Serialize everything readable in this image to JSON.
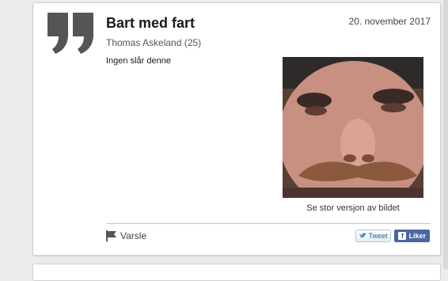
{
  "post": {
    "title": "Bart med fart",
    "date": "20. november 2017",
    "author": "Thomas Askeland (25)",
    "text": "Ingen slår denne",
    "image_caption": "Se stor versjon av bildet"
  },
  "actions": {
    "report_label": "Varsle",
    "tweet_label": "Tweet",
    "like_label": "Liker"
  },
  "icons": {
    "quote": "quote-icon",
    "flag": "flag-icon",
    "twitter": "twitter-bird-icon",
    "facebook": "facebook-icon"
  },
  "colors": {
    "quote_gray": "#555555",
    "facebook_blue": "#4a66a0",
    "twitter_blue": "#2a5f8b"
  }
}
